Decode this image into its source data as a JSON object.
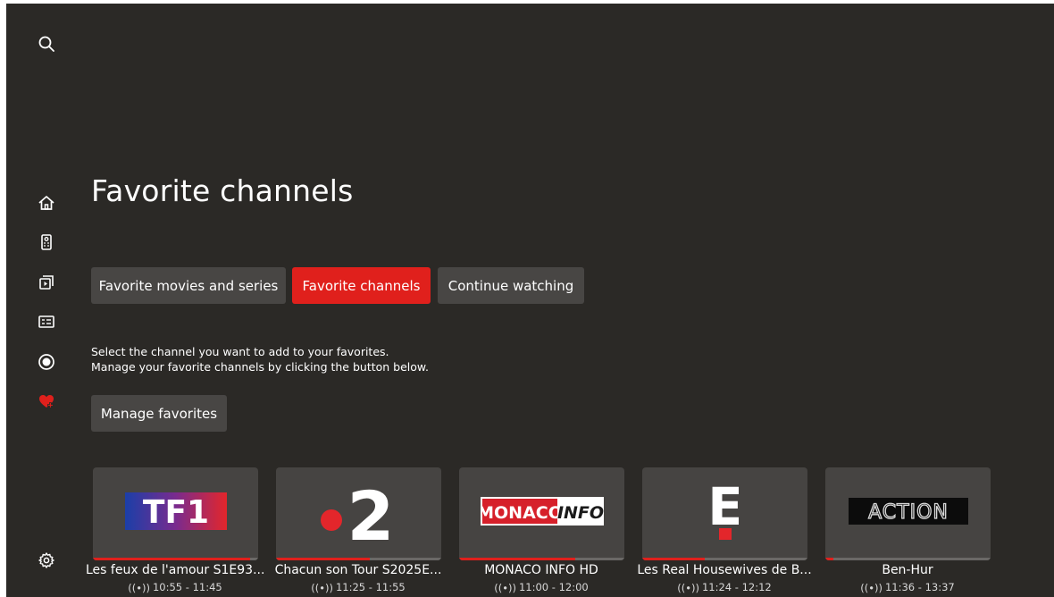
{
  "sidebar": {
    "icons": [
      "search-icon",
      "home-icon",
      "remote-icon",
      "library-icon",
      "guide-icon",
      "record-icon",
      "favorites-heart-icon",
      "settings-gear-icon"
    ],
    "active": "favorites-heart-icon",
    "accent": "#e0201c"
  },
  "page": {
    "title": "Favorite channels"
  },
  "tabs": [
    {
      "label": "Favorite movies and series",
      "active": false
    },
    {
      "label": "Favorite channels",
      "active": true
    },
    {
      "label": "Continue watching",
      "active": false
    }
  ],
  "description": {
    "line1": "Select the channel you want to add to your favorites.",
    "line2": "Manage your favorite channels by clicking the button below."
  },
  "manage_button": {
    "label": "Manage favorites"
  },
  "channels": [
    {
      "logo_text": "TF1",
      "program": "Les feux de l'amour S1E93...",
      "time": "10:55 - 11:45",
      "progress": 0.95
    },
    {
      "logo_text": "2",
      "program": "Chacun son Tour S2025E...",
      "time": "11:25 - 11:55",
      "progress": 0.57
    },
    {
      "logo_text_a": "MONACO",
      "logo_text_b": "INFO",
      "program": "MONACO INFO HD",
      "time": "11:00 - 12:00",
      "progress": 0.7
    },
    {
      "logo_text": "E",
      "program": "Les Real Housewives de B...",
      "time": "11:24 - 12:12",
      "progress": 0.38
    },
    {
      "logo_text": "ACTION",
      "program": "Ben-Hur",
      "time": "11:36 - 13:37",
      "progress": 0.05
    }
  ]
}
